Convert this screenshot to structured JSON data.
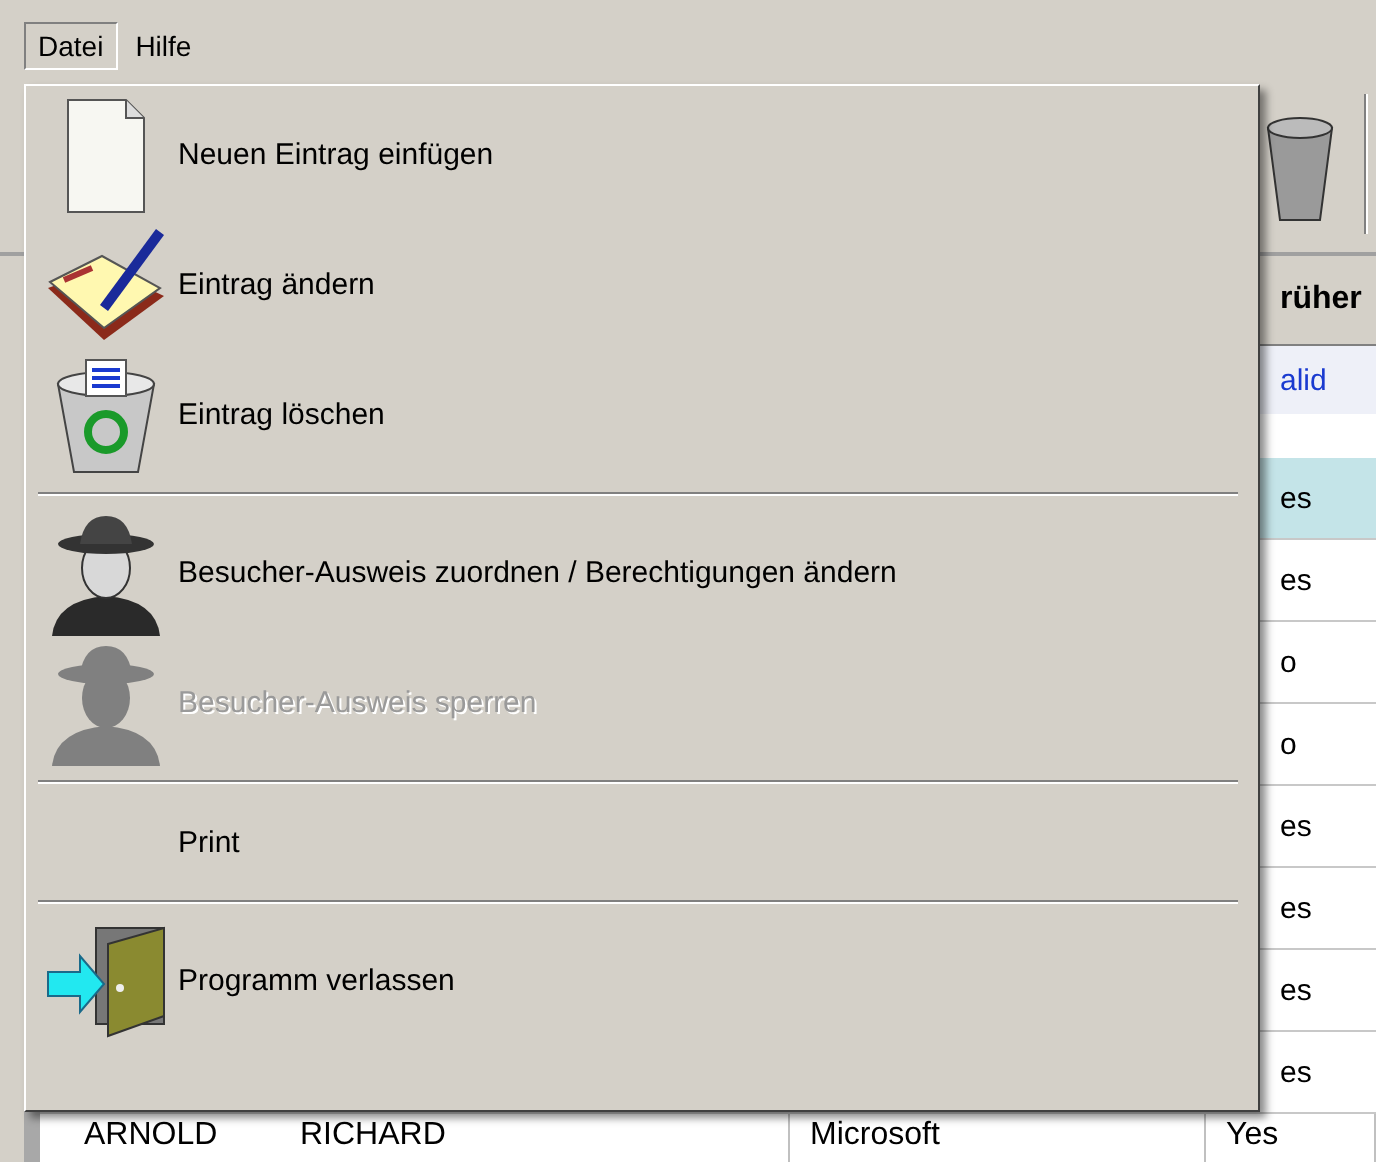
{
  "menubar": [
    {
      "label": "Datei",
      "selected": true
    },
    {
      "label": "Hilfe",
      "selected": false
    }
  ],
  "grid": {
    "header": "rüher",
    "filter": "alid",
    "rows": [
      {
        "value": "es",
        "selected": true
      },
      {
        "value": "es",
        "selected": false
      },
      {
        "value": "o",
        "selected": false
      },
      {
        "value": "o",
        "selected": false
      },
      {
        "value": "es",
        "selected": false
      },
      {
        "value": "es",
        "selected": false
      },
      {
        "value": "es",
        "selected": false
      },
      {
        "value": "es",
        "selected": false
      }
    ],
    "bottom_row": [
      "ARNOLD",
      "RICHARD",
      "Microsoft",
      "Yes"
    ]
  },
  "menu": {
    "items": [
      {
        "kind": "item",
        "label": "Neuen Eintrag einfügen",
        "disabled": false
      },
      {
        "kind": "item",
        "label": "Eintrag ändern",
        "disabled": false
      },
      {
        "kind": "item",
        "label": "Eintrag löschen",
        "disabled": false
      },
      {
        "kind": "separator"
      },
      {
        "kind": "item",
        "label": "Besucher-Ausweis zuordnen / Berechtigungen ändern",
        "disabled": false
      },
      {
        "kind": "item",
        "label": "Besucher-Ausweis sperren",
        "disabled": true
      },
      {
        "kind": "separator"
      },
      {
        "kind": "item",
        "label": "Print",
        "disabled": false
      },
      {
        "kind": "separator"
      },
      {
        "kind": "item",
        "label": "Programm verlassen",
        "disabled": false
      }
    ]
  }
}
